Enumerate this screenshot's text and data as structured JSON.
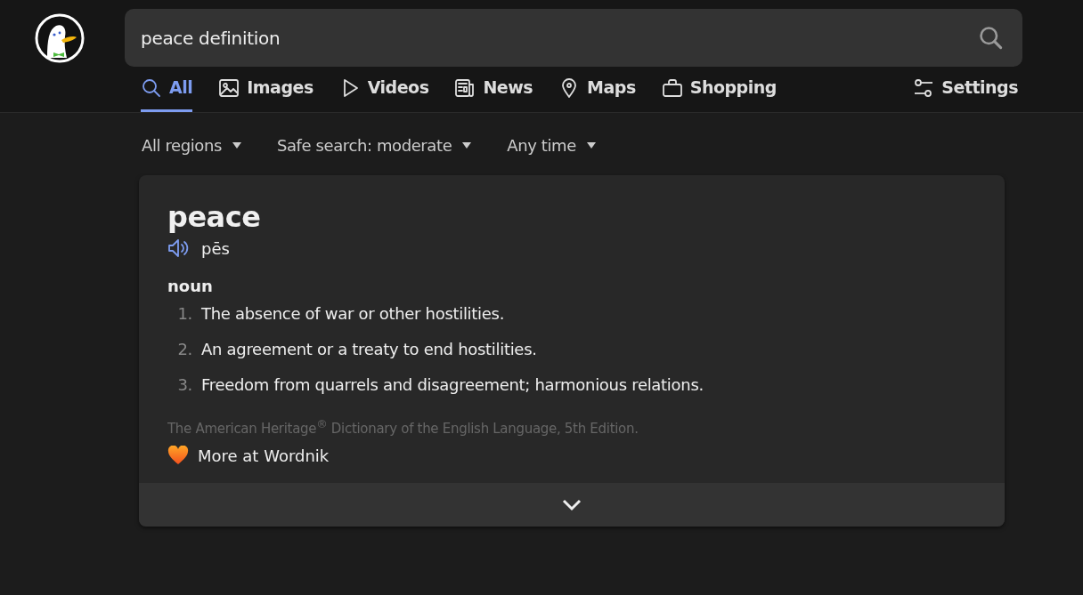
{
  "search": {
    "value": "peace definition"
  },
  "tabs": [
    {
      "label": "All",
      "kind": "search",
      "selected": true
    },
    {
      "label": "Images",
      "kind": "image",
      "selected": false
    },
    {
      "label": "Videos",
      "kind": "play",
      "selected": false
    },
    {
      "label": "News",
      "kind": "news",
      "selected": false
    },
    {
      "label": "Maps",
      "kind": "pin",
      "selected": false
    },
    {
      "label": "Shopping",
      "kind": "bag",
      "selected": false
    }
  ],
  "settings": {
    "label": "Settings"
  },
  "filters": [
    "All regions",
    "Safe search: moderate",
    "Any time"
  ],
  "definition": {
    "word": "peace",
    "pronunciation": "pēs",
    "part_of_speech": "noun",
    "senses": [
      {
        "number": "1.",
        "text": "The absence of war or other hostilities."
      },
      {
        "number": "2.",
        "text": "An agreement or a treaty to end hostilities."
      },
      {
        "number": "3.",
        "text": "Freedom from quarrels and disagreement; harmonious relations."
      }
    ],
    "source": "The American Heritage$^{®}$ Dictionary of the English Language, 5th Edition.",
    "more_link": "More at Wordnik"
  }
}
